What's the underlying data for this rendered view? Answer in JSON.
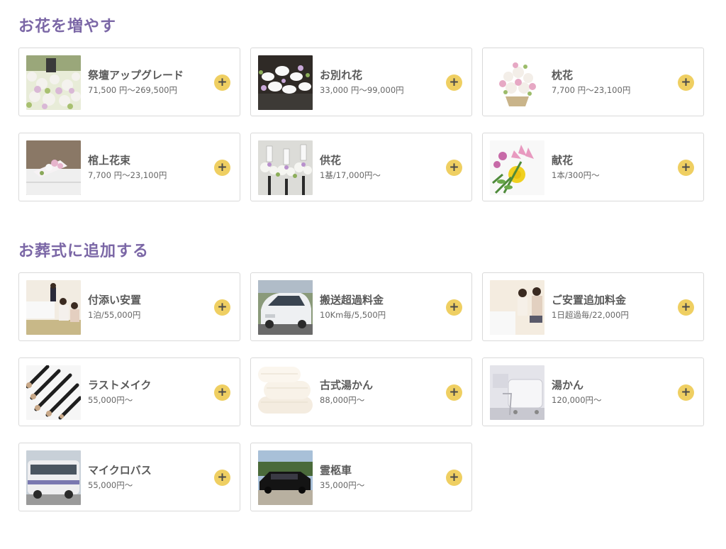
{
  "sections": [
    {
      "title": "お花を増やす",
      "items": [
        {
          "name": "祭壇アップグレード",
          "price": "71,500 円〜269,500円",
          "icon": "altar-flowers-photo"
        },
        {
          "name": "お別れ花",
          "price": "33,000 円〜99,000円",
          "icon": "farewell-flowers-photo"
        },
        {
          "name": "枕花",
          "price": "7,700 円〜23,100円",
          "icon": "pillow-flowers-photo"
        },
        {
          "name": "棺上花束",
          "price": "7,700 円〜23,100円",
          "icon": "coffin-bouquet-photo"
        },
        {
          "name": "供花",
          "price": "1基/17,000円〜",
          "icon": "offering-flowers-photo"
        },
        {
          "name": "献花",
          "price": "1本/300円〜",
          "icon": "flower-tribute-photo"
        }
      ]
    },
    {
      "title": "お葬式に追加する",
      "items": [
        {
          "name": "付添い安置",
          "price": "1泊/55,000円",
          "icon": "attended-laying-photo"
        },
        {
          "name": "搬送超過料金",
          "price": "10Km毎/5,500円",
          "icon": "transport-car-photo"
        },
        {
          "name": "ご安置追加料金",
          "price": "1日超過毎/22,000円",
          "icon": "extra-laying-photo"
        },
        {
          "name": "ラストメイク",
          "price": "55,000円〜",
          "icon": "makeup-brushes-photo"
        },
        {
          "name": "古式湯かん",
          "price": "88,000円〜",
          "icon": "towels-photo"
        },
        {
          "name": "湯かん",
          "price": "120,000円〜",
          "icon": "bathtub-photo"
        },
        {
          "name": "マイクロバス",
          "price": "55,000円〜",
          "icon": "microbus-photo"
        },
        {
          "name": "霊柩車",
          "price": "35,000円〜",
          "icon": "hearse-photo"
        }
      ]
    }
  ],
  "add_button_label": "+",
  "colors": {
    "section_title": "#7b67a6",
    "add_button": "#efcf62",
    "card_border": "#d9d9d9"
  }
}
